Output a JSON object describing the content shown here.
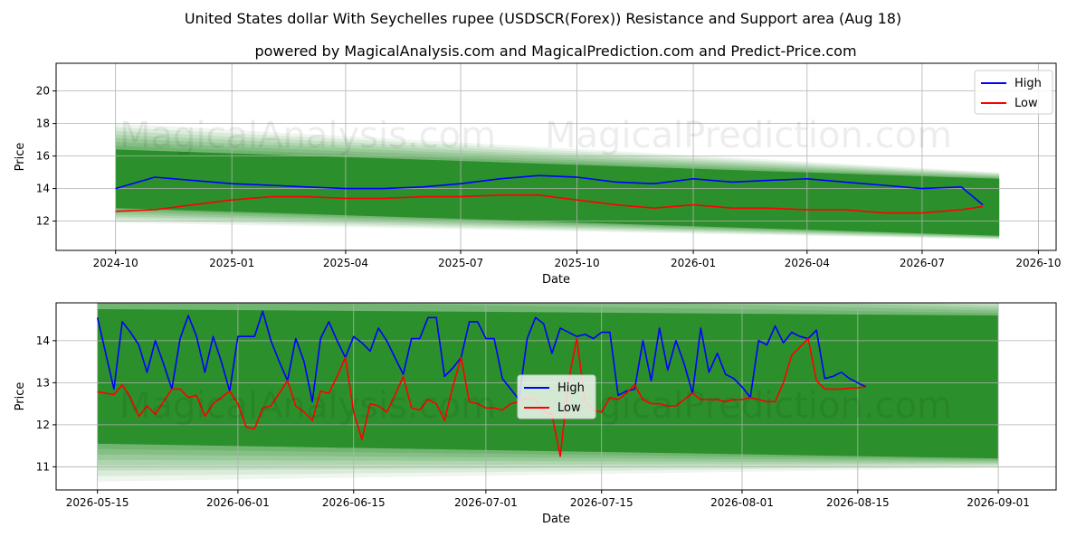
{
  "title": "United States dollar With Seychelles rupee (USDSCR(Forex)) Resistance and Support area (Aug 18)",
  "subtitle": "powered by MagicalAnalysis.com and MagicalPrediction.com and Predict-Price.com",
  "watermarks": [
    "MagicalAnalysis.com",
    "MagicalPrediction.com"
  ],
  "colors": {
    "high": "#0000ff",
    "low": "#ff0000",
    "band": "#228b22",
    "band_light": "#9acd9a",
    "grid": "#b0b0b0"
  },
  "chart_data": [
    {
      "type": "line",
      "xlabel": "Date",
      "ylabel": "Price",
      "x_ticks": [
        "2024-10",
        "2025-01",
        "2025-04",
        "2025-07",
        "2025-10",
        "2026-01",
        "2026-04",
        "2026-07",
        "2026-10"
      ],
      "y_ticks": [
        12,
        14,
        16,
        18,
        20
      ],
      "xlim": [
        "2024-08-15",
        "2026-10-15"
      ],
      "ylim": [
        10.2,
        21.7
      ],
      "grid": true,
      "legend": "top-right",
      "series": [
        {
          "name": "High",
          "color": "#0000ff",
          "x": [
            "2024-10-01",
            "2024-11-01",
            "2024-12-01",
            "2025-01-01",
            "2025-02-01",
            "2025-03-01",
            "2025-04-01",
            "2025-05-01",
            "2025-06-01",
            "2025-07-01",
            "2025-08-01",
            "2025-09-01",
            "2025-10-01",
            "2025-11-01",
            "2025-12-01",
            "2026-01-01",
            "2026-02-01",
            "2026-03-01",
            "2026-04-01",
            "2026-05-01",
            "2026-06-01",
            "2026-07-01",
            "2026-08-01",
            "2026-08-18"
          ],
          "values": [
            14.0,
            14.7,
            14.5,
            14.3,
            14.2,
            14.1,
            14.0,
            14.0,
            14.1,
            14.3,
            14.6,
            14.8,
            14.7,
            14.4,
            14.3,
            14.6,
            14.4,
            14.5,
            14.6,
            14.4,
            14.2,
            14.0,
            14.1,
            13.0
          ]
        },
        {
          "name": "Low",
          "color": "#ff0000",
          "x": [
            "2024-10-01",
            "2024-11-01",
            "2024-12-01",
            "2025-01-01",
            "2025-02-01",
            "2025-03-01",
            "2025-04-01",
            "2025-05-01",
            "2025-06-01",
            "2025-07-01",
            "2025-08-01",
            "2025-09-01",
            "2025-10-01",
            "2025-11-01",
            "2025-12-01",
            "2026-01-01",
            "2026-02-01",
            "2026-03-01",
            "2026-04-01",
            "2026-05-01",
            "2026-06-01",
            "2026-07-01",
            "2026-08-01",
            "2026-08-18"
          ],
          "values": [
            12.6,
            12.7,
            13.0,
            13.3,
            13.5,
            13.5,
            13.4,
            13.4,
            13.5,
            13.5,
            13.6,
            13.6,
            13.3,
            13.0,
            12.8,
            13.0,
            12.8,
            12.8,
            12.7,
            12.7,
            12.5,
            12.5,
            12.7,
            12.9
          ]
        }
      ],
      "band": {
        "start": "2024-10-01",
        "end": "2026-08-31",
        "upper": [
          16.4,
          14.6
        ],
        "lower": [
          12.8,
          11.1
        ]
      }
    },
    {
      "type": "line",
      "xlabel": "Date",
      "ylabel": "Price",
      "x_ticks": [
        "2026-05-15",
        "2026-06-01",
        "2026-06-15",
        "2026-07-01",
        "2026-07-15",
        "2026-08-01",
        "2026-08-15",
        "2026-09-01"
      ],
      "y_ticks": [
        11,
        12,
        13,
        14
      ],
      "xlim": [
        "2026-05-10",
        "2026-09-08"
      ],
      "ylim": [
        10.45,
        14.9
      ],
      "grid": true,
      "legend": "center",
      "series": [
        {
          "name": "High",
          "color": "#0000ff",
          "x": [
            "2026-05-15",
            "2026-05-16",
            "2026-05-17",
            "2026-05-18",
            "2026-05-19",
            "2026-05-20",
            "2026-05-21",
            "2026-05-22",
            "2026-05-23",
            "2026-05-24",
            "2026-05-25",
            "2026-05-26",
            "2026-05-27",
            "2026-05-28",
            "2026-05-29",
            "2026-05-30",
            "2026-05-31",
            "2026-06-01",
            "2026-06-02",
            "2026-06-03",
            "2026-06-04",
            "2026-06-05",
            "2026-06-06",
            "2026-06-07",
            "2026-06-08",
            "2026-06-09",
            "2026-06-10",
            "2026-06-11",
            "2026-06-12",
            "2026-06-13",
            "2026-06-14",
            "2026-06-15",
            "2026-06-16",
            "2026-06-17",
            "2026-06-18",
            "2026-06-19",
            "2026-06-20",
            "2026-06-21",
            "2026-06-22",
            "2026-06-23",
            "2026-06-24",
            "2026-06-25",
            "2026-06-26",
            "2026-06-27",
            "2026-06-28",
            "2026-06-29",
            "2026-06-30",
            "2026-07-01",
            "2026-07-02",
            "2026-07-03",
            "2026-07-04",
            "2026-07-05",
            "2026-07-06",
            "2026-07-07",
            "2026-07-08",
            "2026-07-09",
            "2026-07-10",
            "2026-07-11",
            "2026-07-12",
            "2026-07-13",
            "2026-07-14",
            "2026-07-15",
            "2026-07-16",
            "2026-07-17",
            "2026-07-18",
            "2026-07-19",
            "2026-07-20",
            "2026-07-21",
            "2026-07-22",
            "2026-07-23",
            "2026-07-24",
            "2026-07-25",
            "2026-07-26",
            "2026-07-27",
            "2026-07-28",
            "2026-07-29",
            "2026-07-30",
            "2026-07-31",
            "2026-08-01",
            "2026-08-02",
            "2026-08-03",
            "2026-08-04",
            "2026-08-05",
            "2026-08-06",
            "2026-08-07",
            "2026-08-08",
            "2026-08-09",
            "2026-08-10",
            "2026-08-11",
            "2026-08-12",
            "2026-08-13",
            "2026-08-14",
            "2026-08-15",
            "2026-08-16"
          ],
          "values": [
            14.55,
            13.7,
            12.85,
            14.45,
            14.2,
            13.9,
            13.25,
            14.0,
            13.45,
            12.85,
            14.05,
            14.6,
            14.1,
            13.25,
            14.1,
            13.5,
            12.8,
            14.1,
            14.1,
            14.1,
            14.7,
            14.0,
            13.5,
            13.05,
            14.05,
            13.5,
            12.55,
            14.05,
            14.45,
            14.0,
            13.6,
            14.1,
            13.95,
            13.75,
            14.3,
            14.0,
            13.6,
            13.2,
            14.05,
            14.05,
            14.55,
            14.55,
            13.15,
            13.35,
            13.6,
            14.45,
            14.45,
            14.05,
            14.05,
            13.1,
            12.85,
            12.6,
            14.05,
            14.55,
            14.4,
            13.7,
            14.3,
            14.2,
            14.1,
            14.15,
            14.05,
            14.2,
            14.2,
            12.7,
            12.8,
            12.85,
            14.0,
            13.05,
            14.3,
            13.3,
            14.0,
            13.45,
            12.75,
            14.3,
            13.25,
            13.7,
            13.2,
            13.1,
            12.9,
            12.65,
            14.0,
            13.9,
            14.35,
            13.95,
            14.2,
            14.1,
            14.05,
            14.25,
            13.1,
            13.15,
            13.25,
            13.1,
            13.0,
            12.9
          ]
        },
        {
          "name": "Low",
          "color": "#ff0000",
          "x": [
            "2026-05-15",
            "2026-05-16",
            "2026-05-17",
            "2026-05-18",
            "2026-05-19",
            "2026-05-20",
            "2026-05-21",
            "2026-05-22",
            "2026-05-23",
            "2026-05-24",
            "2026-05-25",
            "2026-05-26",
            "2026-05-27",
            "2026-05-28",
            "2026-05-29",
            "2026-05-30",
            "2026-05-31",
            "2026-06-01",
            "2026-06-02",
            "2026-06-03",
            "2026-06-04",
            "2026-06-05",
            "2026-06-06",
            "2026-06-07",
            "2026-06-08",
            "2026-06-09",
            "2026-06-10",
            "2026-06-11",
            "2026-06-12",
            "2026-06-13",
            "2026-06-14",
            "2026-06-15",
            "2026-06-16",
            "2026-06-17",
            "2026-06-18",
            "2026-06-19",
            "2026-06-20",
            "2026-06-21",
            "2026-06-22",
            "2026-06-23",
            "2026-06-24",
            "2026-06-25",
            "2026-06-26",
            "2026-06-27",
            "2026-06-28",
            "2026-06-29",
            "2026-06-30",
            "2026-07-01",
            "2026-07-02",
            "2026-07-03",
            "2026-07-04",
            "2026-07-05",
            "2026-07-06",
            "2026-07-07",
            "2026-07-08",
            "2026-07-09",
            "2026-07-10",
            "2026-07-11",
            "2026-07-12",
            "2026-07-13",
            "2026-07-14",
            "2026-07-15",
            "2026-07-16",
            "2026-07-17",
            "2026-07-18",
            "2026-07-19",
            "2026-07-20",
            "2026-07-21",
            "2026-07-22",
            "2026-07-23",
            "2026-07-24",
            "2026-07-25",
            "2026-07-26",
            "2026-07-27",
            "2026-07-28",
            "2026-07-29",
            "2026-07-30",
            "2026-07-31",
            "2026-08-01",
            "2026-08-02",
            "2026-08-03",
            "2026-08-04",
            "2026-08-05",
            "2026-08-06",
            "2026-08-07",
            "2026-08-08",
            "2026-08-09",
            "2026-08-10",
            "2026-08-11",
            "2026-08-12",
            "2026-08-13",
            "2026-08-14",
            "2026-08-15",
            "2026-08-16"
          ],
          "values": [
            12.78,
            12.75,
            12.72,
            12.95,
            12.65,
            12.2,
            12.45,
            12.25,
            12.55,
            12.85,
            12.85,
            12.65,
            12.7,
            12.2,
            12.5,
            12.65,
            12.8,
            12.5,
            11.95,
            11.9,
            12.4,
            12.45,
            12.75,
            13.05,
            12.45,
            12.3,
            12.1,
            12.8,
            12.75,
            13.15,
            13.6,
            12.3,
            11.65,
            12.5,
            12.45,
            12.3,
            12.7,
            13.15,
            12.4,
            12.35,
            12.6,
            12.5,
            12.1,
            12.9,
            13.6,
            12.55,
            12.5,
            12.4,
            12.4,
            12.35,
            12.5,
            12.55,
            12.65,
            12.6,
            12.3,
            12.25,
            11.25,
            13.05,
            14.05,
            12.55,
            12.35,
            12.3,
            12.65,
            12.6,
            12.75,
            12.95,
            12.6,
            12.5,
            12.5,
            12.45,
            12.45,
            12.6,
            12.75,
            12.6,
            12.6,
            12.6,
            12.55,
            12.6,
            12.6,
            12.65,
            12.6,
            12.55,
            12.55,
            13.0,
            13.65,
            13.85,
            14.05,
            13.05,
            12.85,
            12.85,
            12.85,
            12.87,
            12.88,
            12.9
          ]
        }
      ],
      "band": {
        "start": "2026-05-15",
        "end": "2026-09-01",
        "upper": [
          14.75,
          14.6
        ],
        "lower": [
          11.55,
          11.2
        ]
      }
    }
  ]
}
